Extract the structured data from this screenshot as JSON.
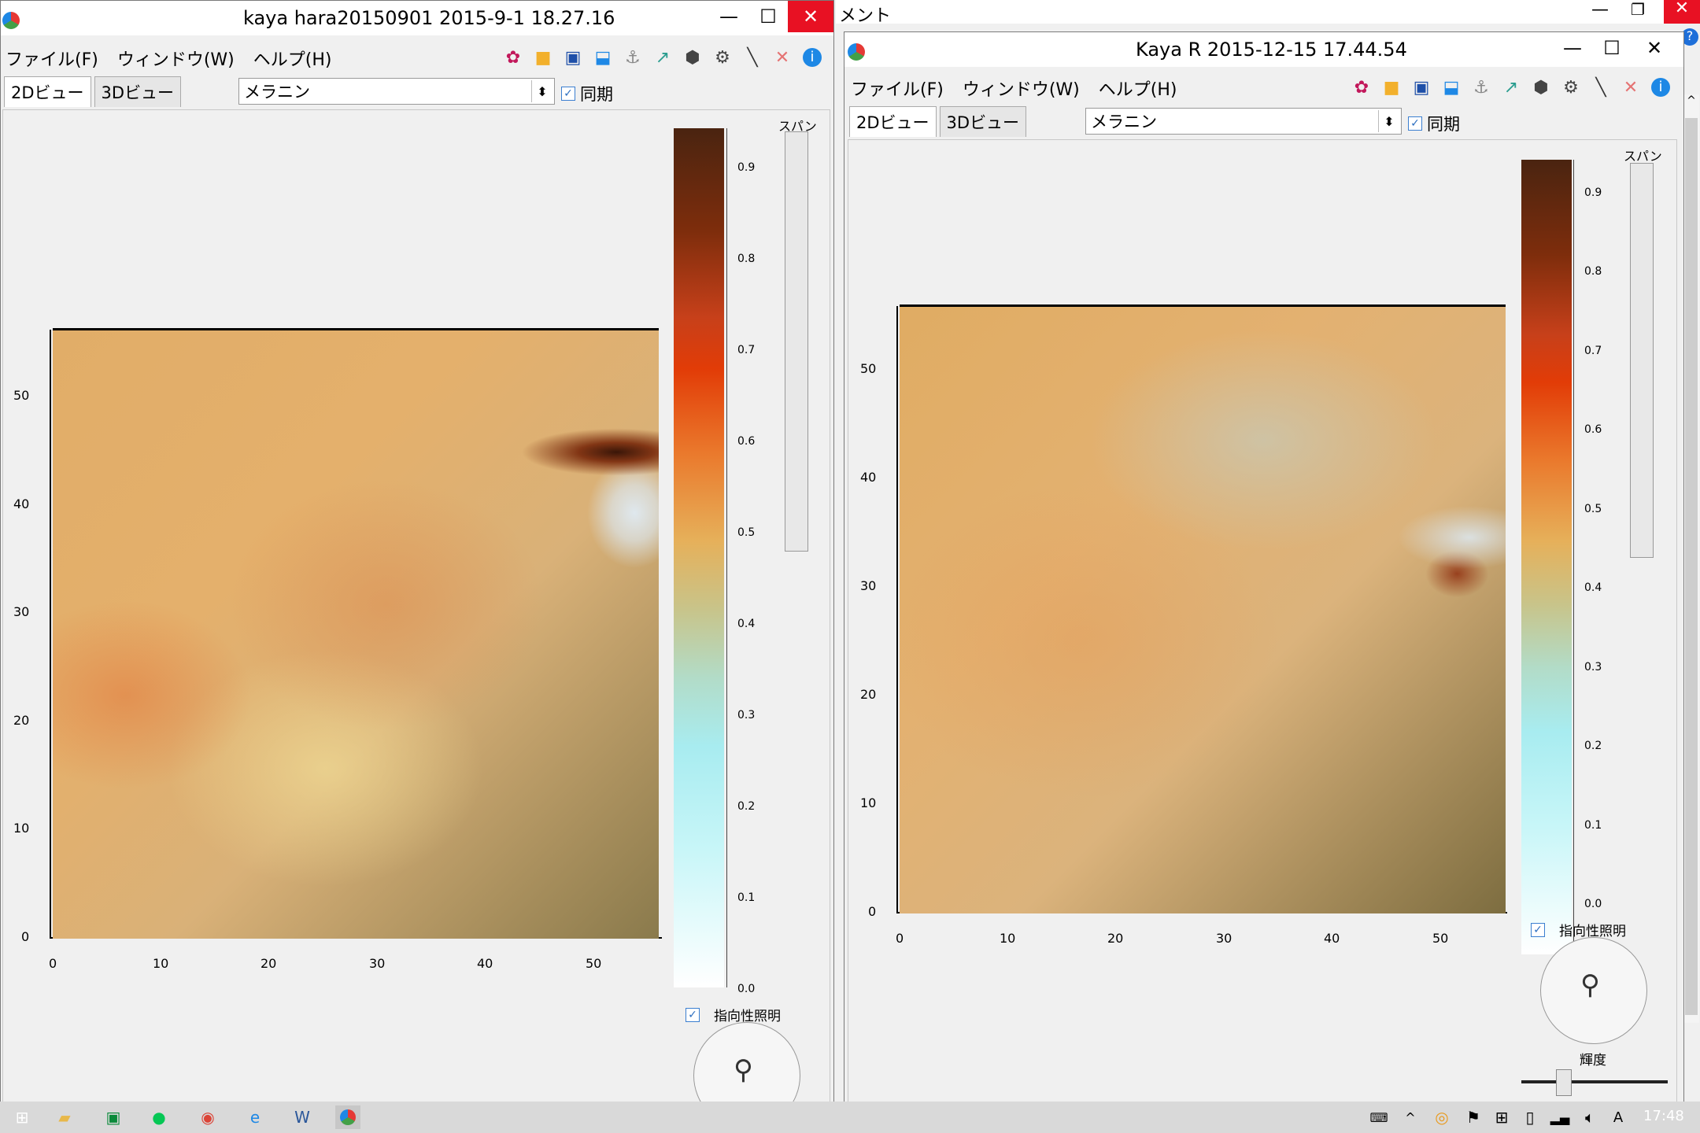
{
  "background_title": "メント",
  "window1": {
    "title": "kaya hara20150901 2015-9-1 18.27.16",
    "menu": [
      "ファイル(F)",
      "ウィンドウ(W)",
      "ヘルプ(H)"
    ],
    "tabs": [
      "2Dビュー",
      "3Dビュー"
    ],
    "dropdown_value": "メラニン",
    "sync_label": "同期",
    "span_label": "スパン",
    "lighting_label": "指向性照明",
    "colorbar_ticks": [
      "0.9",
      "0.8",
      "0.7",
      "0.6",
      "0.5",
      "0.4",
      "0.3",
      "0.2",
      "0.1",
      "0.0"
    ],
    "y_ticks": [
      "50",
      "40",
      "30",
      "20",
      "10",
      "0"
    ],
    "x_ticks": [
      "0",
      "10",
      "20",
      "30",
      "40",
      "50"
    ]
  },
  "window2": {
    "title": "Kaya R 2015-12-15 17.44.54",
    "menu": [
      "ファイル(F)",
      "ウィンドウ(W)",
      "ヘルプ(H)"
    ],
    "tabs": [
      "2Dビュー",
      "3Dビュー"
    ],
    "dropdown_value": "メラニン",
    "sync_label": "同期",
    "span_label": "スパン",
    "lighting_label": "指向性照明",
    "brightness_label": "輝度",
    "colorbar_ticks": [
      "0.9",
      "0.8",
      "0.7",
      "0.6",
      "0.5",
      "0.4",
      "0.3",
      "0.2",
      "0.1",
      "0.0"
    ],
    "y_ticks": [
      "50",
      "40",
      "30",
      "20",
      "10",
      "0"
    ],
    "x_ticks": [
      "0",
      "10",
      "20",
      "30",
      "40",
      "50"
    ]
  },
  "taskbar": {
    "time": "17:48",
    "ime": "A"
  },
  "colors": {
    "close": "#e81123",
    "accent": "#3b7fd0"
  }
}
